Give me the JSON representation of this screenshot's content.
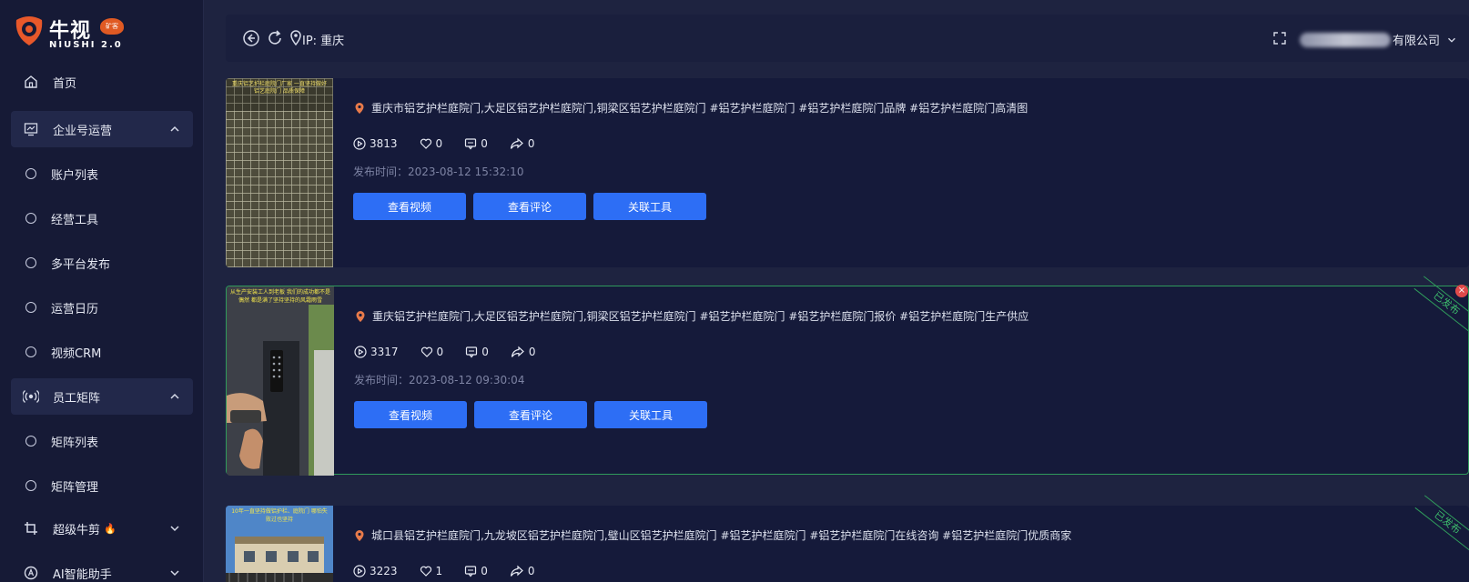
{
  "brand": {
    "name": "牛视",
    "sub": "NIUSHI 2.0",
    "badge": "矿客"
  },
  "sidebar": {
    "items": [
      {
        "label": "首页",
        "icon": "home-icon"
      },
      {
        "label": "企业号运营",
        "icon": "monitor-chart-icon"
      },
      {
        "label": "账户列表"
      },
      {
        "label": "经营工具"
      },
      {
        "label": "多平台发布"
      },
      {
        "label": "运营日历"
      },
      {
        "label": "视频CRM"
      },
      {
        "label": "员工矩阵",
        "icon": "broadcast-icon"
      },
      {
        "label": "矩阵列表"
      },
      {
        "label": "矩阵管理"
      },
      {
        "label": "超级牛剪",
        "icon": "crop-icon"
      },
      {
        "label": "AI智能助手",
        "icon": "ai-assistant-icon"
      }
    ]
  },
  "header": {
    "ip_label": "IP: 重庆",
    "company_suffix": "有限公司"
  },
  "videos": [
    {
      "title": "重庆市铝艺护栏庭院门,大足区铝艺护栏庭院门,铜梁区铝艺护栏庭院门 #铝艺护栏庭院门 #铝艺护栏庭院门品牌 #铝艺护栏庭院门高清图",
      "views": "3813",
      "likes": "0",
      "comments": "0",
      "shares": "0",
      "publish_time": "发布时间：2023-08-12 15:32:10",
      "thumb_caption": "重庆铝艺护栏庭院门厂家 一直坚持做好铝艺庭院门 品质保障"
    },
    {
      "title": "重庆铝艺护栏庭院门,大足区铝艺护栏庭院门,铜梁区铝艺护栏庭院门 #铝艺护栏庭院门 #铝艺护栏庭院门报价 #铝艺护栏庭院门生产供应",
      "views": "3317",
      "likes": "0",
      "comments": "0",
      "shares": "0",
      "publish_time": "发布时间：2023-08-12 09:30:04",
      "thumb_caption": "从生产安装工人到老板 我们的成功都不是偶然 都是满了坚持坚持的风霜雨雪",
      "status": "已发布"
    },
    {
      "title": "城口县铝艺护栏庭院门,九龙坡区铝艺护栏庭院门,璧山区铝艺护栏庭院门 #铝艺护栏庭院门 #铝艺护栏庭院门在线咨询 #铝艺护栏庭院门优质商家",
      "views": "3223",
      "likes": "1",
      "comments": "0",
      "shares": "0",
      "thumb_caption": "10年一直坚持做铝护栏、庭院门 哪怕失败过也坚持",
      "status": "已发布"
    }
  ],
  "buttons": {
    "view_video": "查看视频",
    "view_comments": "查看评论",
    "link_tool": "关联工具"
  },
  "colors": {
    "primary_button": "#2d6ef5",
    "sidebar_bg": "#161a36",
    "card_bg": "#151a3a",
    "published": "#3dbb6c"
  }
}
